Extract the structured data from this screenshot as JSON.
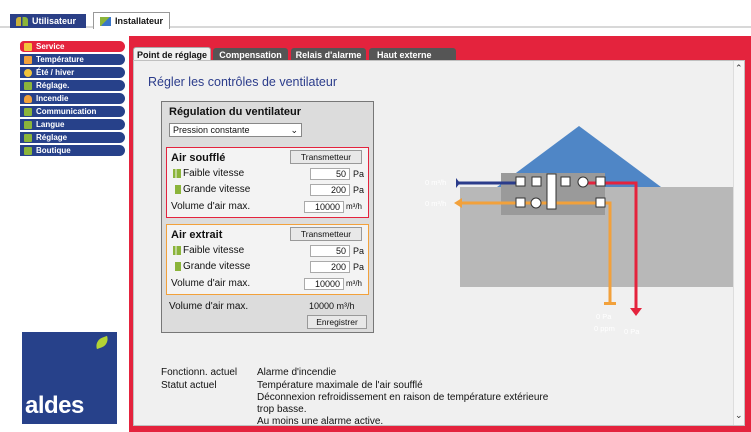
{
  "top_tabs": [
    "Utilisateur",
    "Installateur"
  ],
  "sidebar": [
    {
      "label": "Service",
      "color": "#e4233d"
    },
    {
      "label": "Température",
      "color": "#f2a13b"
    },
    {
      "label": "Été / hiver",
      "color": "#f2c43b"
    },
    {
      "label": "Réglage.",
      "color": "#8bb43a"
    },
    {
      "label": "Incendie",
      "color": "#f2a13b"
    },
    {
      "label": "Communication",
      "color": "#8bb43a"
    },
    {
      "label": "Langue",
      "color": "#8bb43a"
    },
    {
      "label": "Réglage",
      "color": "#8bb43a"
    },
    {
      "label": "Boutique",
      "color": "#8bb43a"
    }
  ],
  "logo": {
    "text": "aldes"
  },
  "sub_tabs": [
    "Point de réglage",
    "Compensation",
    "Relais d'alarme",
    "Haut externe"
  ],
  "heading": "Régler les contrôles de ventilateur",
  "regulation": {
    "title": "Régulation du ventilateur",
    "select_value": "Pression constante",
    "supply": {
      "title": "Air soufflé",
      "button": "Transmetteur",
      "low_label": "Faible vitesse",
      "low_value": "50",
      "low_unit": "Pa",
      "high_label": "Grande vitesse",
      "high_value": "200",
      "high_unit": "Pa",
      "max_label": "Volume d'air max.",
      "max_value": "10000",
      "max_unit": "m³/h"
    },
    "extract": {
      "title": "Air extrait",
      "button": "Transmetteur",
      "low_label": "Faible vitesse",
      "low_value": "50",
      "low_unit": "Pa",
      "high_label": "Grande vitesse",
      "high_value": "200",
      "high_unit": "Pa",
      "max_label": "Volume d'air max.",
      "max_value": "10000",
      "max_unit": "m³/h"
    },
    "total_label": "Volume d'air max.",
    "total_value": "10000 m³/h",
    "save": "Enregistrer"
  },
  "diagram": {
    "flow_in": "0 m³/h",
    "flow_out": "0 m³/h",
    "pressure_sensor": "0 Pa",
    "ppm_sensor": "0 ppm",
    "pressure_supply": "0 Pa"
  },
  "status": {
    "current_function_label": "Fonctionn. actuel",
    "current_function_value": "Alarme d'incendie",
    "current_status_label": "Statut actuel",
    "current_status_lines": [
      "Température maximale de l'air soufflé",
      "Déconnexion refroidissement en raison de température extérieure",
      "trop basse.",
      "Au moins une alarme active."
    ]
  },
  "colors": {
    "accent_red": "#e4233d",
    "nav_blue": "#27418a",
    "supply_blue": "#2b3c8b",
    "extract_orange": "#f2a13b"
  }
}
